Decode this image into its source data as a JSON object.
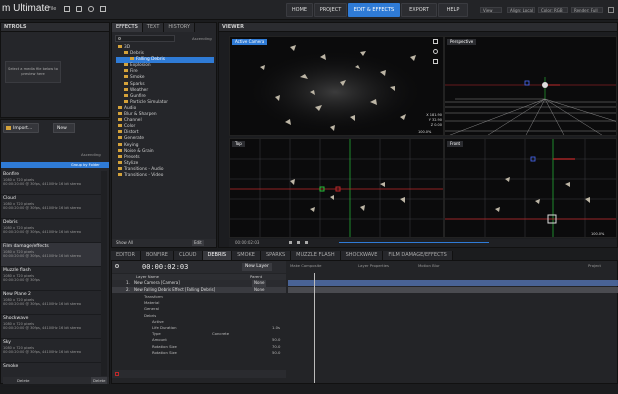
{
  "app": {
    "title": "m Ultimate",
    "file_menu": "File"
  },
  "nav": {
    "home": "HOME",
    "project": "PROJECT",
    "edit": "EDIT & EFFECTS",
    "export": "EXPORT",
    "help": "HELP"
  },
  "top_dropdowns": [
    "View",
    "Align: Local",
    "Color: RGB",
    "Render: Full"
  ],
  "controls": {
    "title": "NTROLS",
    "preview_text": "Select a media file below to preview here"
  },
  "media": {
    "import_label": "Import...",
    "new_label": "New",
    "group_label": "Ascending",
    "group_by": "Group by Folder",
    "items": [
      {
        "name": "Bonfire",
        "info": "1080 x 720 pixels",
        "info2": "00:00:20:00 @ 30fps, 44100Hz 16 bit stereo"
      },
      {
        "name": "Cloud",
        "info": "1080 x 720 pixels",
        "info2": "00:00:20:00 @ 30fps, 44100Hz 16 bit stereo"
      },
      {
        "name": "Debris",
        "info": "1080 x 720 pixels",
        "info2": "00:00:20:00 @ 30fps, 44100Hz 16 bit stereo"
      },
      {
        "name": "Film damage/effects",
        "info": "1080 x 720 pixels",
        "info2": "00:00:20:00 @ 30fps, 44100Hz 16 bit stereo"
      },
      {
        "name": "Muzzle flash",
        "info": "1080 x 720 pixels",
        "info2": "00:00:20:00 @ 30fps"
      },
      {
        "name": "New Plane 2",
        "info": "1080 x 720 pixels",
        "info2": "00:00:20:00 @ 30fps, 44100Hz 16 bit stereo"
      },
      {
        "name": "Shockwave",
        "info": "1080 x 720 pixels",
        "info2": "00:00:20:00 @ 30fps, 44100Hz 16 bit stereo"
      },
      {
        "name": "Sky",
        "info": "1080 x 720 pixels",
        "info2": "00:00:20:00 @ 30fps, 44100Hz 16 bit stereo"
      },
      {
        "name": "Smoke",
        "info": "",
        "info2": ""
      }
    ],
    "footer_left": "Delete",
    "footer_right": "Delete"
  },
  "effects": {
    "tabs": [
      "EFFECTS",
      "TEXT",
      "HISTORY"
    ],
    "search_placeholder": "Search",
    "sort": "Ascending",
    "tree": [
      "3D",
      "Debris",
      "Falling Debris",
      "Explosion",
      "Fire",
      "Smoke",
      "Sparks",
      "Weather",
      "Gunfire",
      "Particle Simulator",
      "Audio",
      "Blur & Sharpen",
      "Channel",
      "Color",
      "Distort",
      "Generate",
      "Keying",
      "Noise & Grain",
      "Presets",
      "Stylize",
      "Transitions - Audio",
      "Transitions - Video"
    ],
    "footer_left": "Show All",
    "footer_right": "Edit"
  },
  "viewer": {
    "title": "VIEWER",
    "active_camera": "Active Camera",
    "perspective": "Perspective",
    "top": "Top",
    "front": "Front",
    "zoom": "100.0%",
    "readout_x": "181.90",
    "readout_y": "32.90",
    "readout_z": "0.00",
    "timecode": "00:00:02:03"
  },
  "editor": {
    "tabs": [
      "EDITOR",
      "BONFIRE",
      "CLOUD",
      "DEBRIS",
      "SMOKE",
      "SPARKS",
      "MUZZLE FLASH",
      "SHOCKWAVE",
      "FILM DAMAGE/EFFECTS"
    ],
    "timecode": "00:00:02:03",
    "new_layer": "New Layer",
    "make_composite": "Make Composite",
    "layer_properties": "Layer Properties",
    "motion_blur": "Motion Blur",
    "project": "Project",
    "col_layer_name": "Layer Name",
    "col_parent": "Parent",
    "layers": [
      {
        "num": "1.",
        "name": "New Camera [Camera]",
        "parent": "None"
      },
      {
        "num": "2.",
        "name": "New Falling Debris Effect [Falling Debris]",
        "parent": "None"
      }
    ],
    "properties": [
      {
        "name": "Transform",
        "value": ""
      },
      {
        "name": "Material",
        "value": ""
      },
      {
        "name": "General",
        "value": ""
      },
      {
        "name": "Debris",
        "value": ""
      },
      {
        "name": "Active",
        "value": ""
      },
      {
        "name": "Life Duration",
        "value": "1.0s"
      },
      {
        "name": "Type",
        "value": "Concrete"
      },
      {
        "name": "Amount",
        "value": "50.0"
      },
      {
        "name": "Rotation Size",
        "value": "70.0"
      },
      {
        "name": "Rotation Size",
        "value": "50.0"
      }
    ]
  },
  "colors": {
    "accent": "#2f7bd6",
    "folder": "#d4a23a",
    "grid_red": "#c0282a",
    "grid_green": "#28c03a",
    "track_blue": "#5a7fc4"
  },
  "icons": [
    "file-icon",
    "search-icon",
    "grid-icon",
    "camera-icon",
    "move-icon",
    "rotate-icon",
    "play-icon",
    "pause-icon",
    "speaker-icon"
  ]
}
